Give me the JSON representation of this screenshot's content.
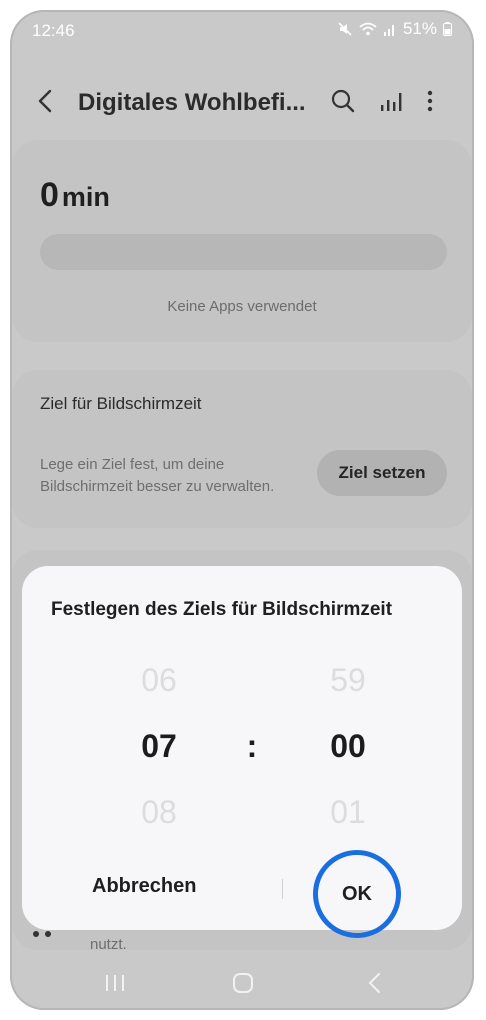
{
  "status_bar": {
    "time": "12:46",
    "battery": "51%"
  },
  "app_bar": {
    "title": "Digitales Wohlbefi..."
  },
  "screen_time": {
    "value": "0",
    "unit": "min",
    "no_apps_text": "Keine Apps verwendet"
  },
  "goal_card": {
    "title": "Ziel für Bildschirmzeit",
    "description": "Lege ein Ziel fest, um deine Bildschirmzeit besser zu verwalten.",
    "button_label": "Ziel setzen"
  },
  "partial_card": {
    "text": "nutzt."
  },
  "dialog": {
    "title": "Festlegen des Ziels für Bildschirmzeit",
    "hours": {
      "prev": "06",
      "selected": "07",
      "next": "08"
    },
    "separator": ":",
    "minutes": {
      "prev": "59",
      "selected": "00",
      "next": "01"
    },
    "cancel_label": "Abbrechen",
    "ok_label": "OK"
  },
  "colors": {
    "highlight": "#1a6fe0",
    "dim_overlay": "#c9c9c9",
    "dialog_bg": "#f7f7f9"
  }
}
